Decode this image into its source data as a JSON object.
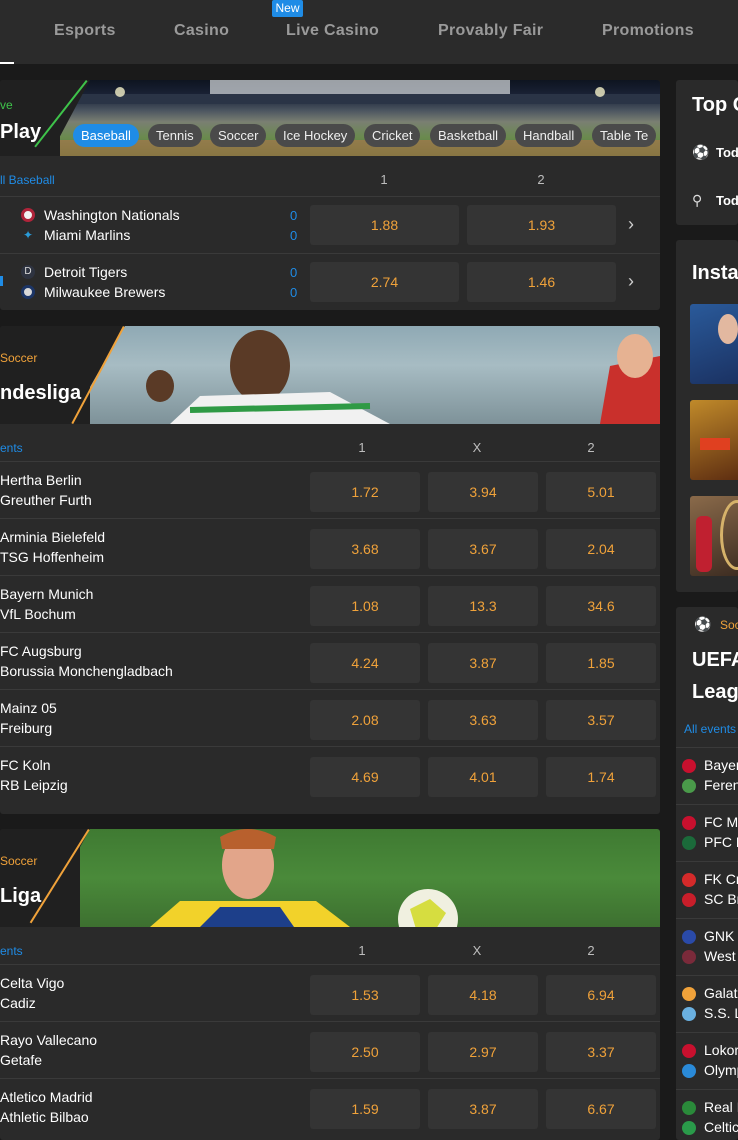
{
  "nav": {
    "items": [
      "Esports",
      "Casino",
      "Live Casino",
      "Provably Fair",
      "Promotions"
    ],
    "new_badge": "New"
  },
  "live": {
    "label": "ve",
    "title": "Play",
    "chips": [
      "Baseball",
      "Tennis",
      "Soccer",
      "Ice Hockey",
      "Cricket",
      "Basketball",
      "Handball",
      "Table Te"
    ],
    "all_link": "ll Baseball",
    "col1": "1",
    "col2": "2",
    "matches": [
      {
        "home": "Washington Nationals",
        "away": "Miami Marlins",
        "home_score": "0",
        "away_score": "0",
        "odd1": "1.88",
        "odd2": "1.93"
      },
      {
        "home": "Detroit Tigers",
        "away": "Milwaukee Brewers",
        "home_score": "0",
        "away_score": "0",
        "odd1": "2.74",
        "odd2": "1.46"
      }
    ]
  },
  "bundesliga": {
    "sport": "Soccer",
    "title": "ndesliga",
    "events_label": "ents",
    "cols": [
      "1",
      "X",
      "2"
    ],
    "matches": [
      {
        "home": "Hertha Berlin",
        "away": "Greuther Furth",
        "odds": [
          "1.72",
          "3.94",
          "5.01"
        ]
      },
      {
        "home": "Arminia Bielefeld",
        "away": "TSG Hoffenheim",
        "odds": [
          "3.68",
          "3.67",
          "2.04"
        ]
      },
      {
        "home": "Bayern Munich",
        "away": "VfL Bochum",
        "odds": [
          "1.08",
          "13.3",
          "34.6"
        ]
      },
      {
        "home": "FC Augsburg",
        "away": "Borussia Monchengladbach",
        "odds": [
          "4.24",
          "3.87",
          "1.85"
        ]
      },
      {
        "home": "Mainz 05",
        "away": "Freiburg",
        "odds": [
          "2.08",
          "3.63",
          "3.57"
        ]
      },
      {
        "home": "FC Koln",
        "away": "RB Leipzig",
        "odds": [
          "4.69",
          "4.01",
          "1.74"
        ]
      }
    ]
  },
  "laliga": {
    "sport": "Soccer",
    "title": "Liga",
    "events_label": "ents",
    "cols": [
      "1",
      "X",
      "2"
    ],
    "matches": [
      {
        "home": "Celta Vigo",
        "away": "Cadiz",
        "odds": [
          "1.53",
          "4.18",
          "6.94"
        ]
      },
      {
        "home": "Rayo Vallecano",
        "away": "Getafe",
        "odds": [
          "2.50",
          "2.97",
          "3.37"
        ]
      },
      {
        "home": "Atletico Madrid",
        "away": "Athletic Bilbao",
        "odds": [
          "1.59",
          "3.87",
          "6.67"
        ]
      }
    ]
  },
  "right": {
    "top_title": "Top C",
    "top_items": [
      "Tod",
      "Tod"
    ],
    "insta_title": "Insta",
    "ucl_sport": "Soc",
    "ucl_title_1": "UEFA",
    "ucl_title_2": "Leag",
    "all_events": "All events",
    "ucl_teams": [
      [
        "Bayer",
        "Feren"
      ],
      [
        "FC M",
        "PFC L"
      ],
      [
        "FK Cr",
        "SC Br"
      ],
      [
        "GNK I",
        "West"
      ],
      [
        "Galat",
        "S.S. L"
      ],
      [
        "Lokor",
        "Olymp"
      ],
      [
        "Real I",
        "Celtic"
      ]
    ]
  },
  "colors": {
    "accent": "#1f8ce6",
    "odds": "#f0a23a",
    "panel": "#2a2a2a",
    "odd_bg": "#343434"
  }
}
